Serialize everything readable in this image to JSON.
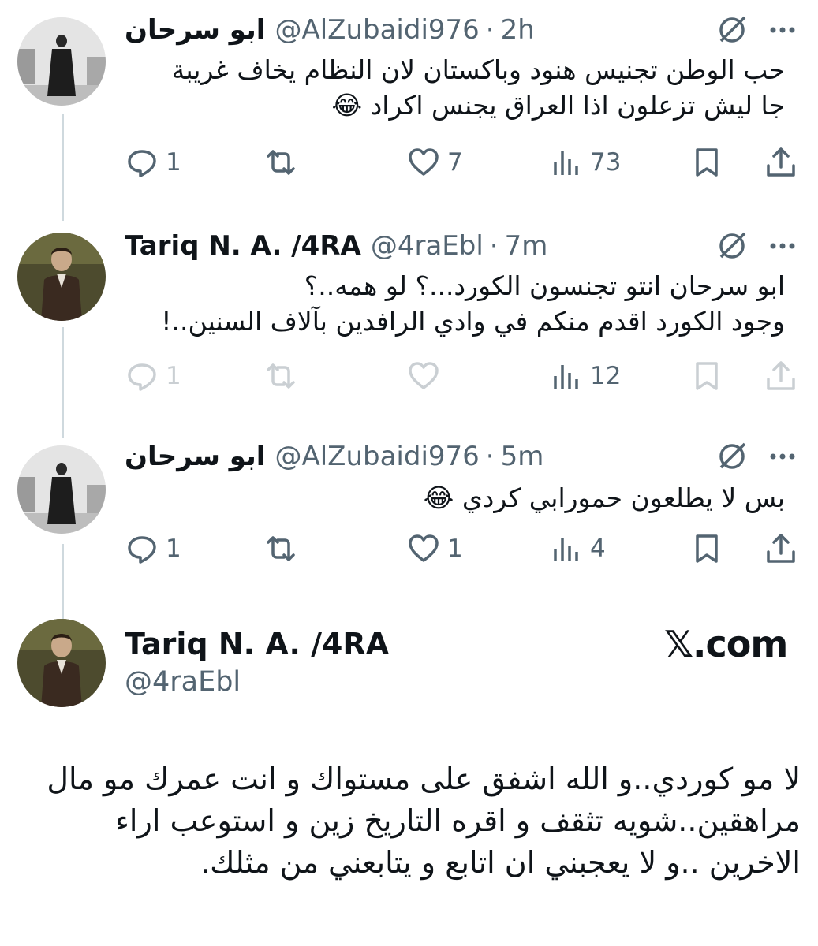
{
  "tweets": [
    {
      "name": "ابو سرحان",
      "handle": "@AlZubaidi976",
      "time": "2h",
      "text": "حب الوطن تجنيس هنود وباكستان لان النظام يخاف غريبة\nجا ليش تزعلون اذا العراق يجنس اكراد 😂",
      "replies": "1",
      "retweets": "",
      "likes": "7",
      "views": "73"
    },
    {
      "name": "Tariq N. A. /4RA",
      "handle": "@4raEbl",
      "time": "7m",
      "text": "ابو سرحان انتو تجنسون الكورد...؟ لو همه..؟\nوجود الكورد اقدم منكم في وادي الرافدين بآلاف السنين..!",
      "replies": "1",
      "retweets": "",
      "likes": "",
      "views": "12"
    },
    {
      "name": "ابو سرحان",
      "handle": "@AlZubaidi976",
      "time": "5m",
      "text": "بس لا يطلعون حمورابي كردي 😂",
      "replies": "1",
      "retweets": "",
      "likes": "1",
      "views": "4"
    }
  ],
  "main_post": {
    "name": "Tariq N. A. /4RA",
    "handle": "@4raEbl",
    "watermark": "𝕏.com",
    "text": "لا مو كوردي..و الله اشفق على مستواك و انت عمرك مو مال مراهقين..شويه تثقف و اقره التاريخ زين و استوعب اراء الاخرين ..و لا يعجبني ان اتابع و يتابعني من مثلك."
  },
  "colors": {
    "text": "#0f1419",
    "secondary": "#536471",
    "thread_line": "#cfd9de"
  }
}
